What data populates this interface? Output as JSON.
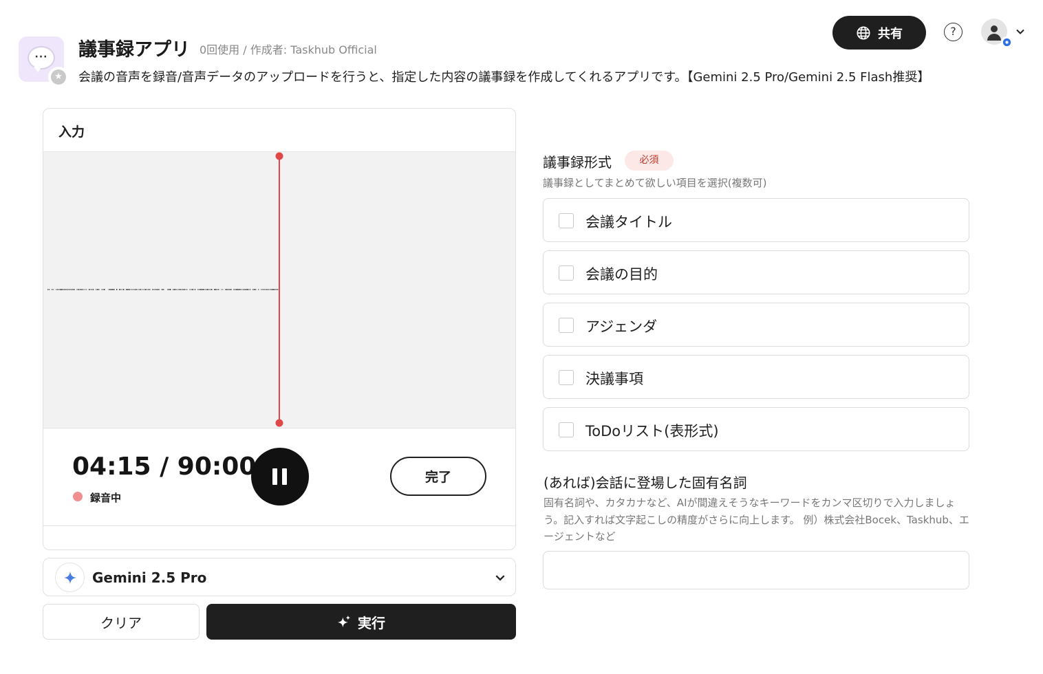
{
  "app": {
    "title": "議事録アプリ",
    "meta": "0回使用 / 作成者: Taskhub Official",
    "description": "会議の音声を録音/音声データのアップロードを行うと、指定した内容の議事録を作成してくれるアプリです。【Gemini 2.5 Pro/Gemini 2.5 Flash推奨】",
    "icon": "speech-bubble-icon",
    "badge_icon": "star-icon"
  },
  "header": {
    "share_label": "共有",
    "share_icon": "globe-icon",
    "help_icon": "question-icon",
    "avatar_icon": "user-icon",
    "settings_badge_icon": "gear-icon",
    "menu_icon": "chevron-down-icon"
  },
  "input_panel": {
    "title": "入力",
    "timer": "04:15 / 90:00",
    "status": "録音中",
    "status_color": "#ef8f8f",
    "playhead_color": "#e04848",
    "pause_icon": "pause-icon",
    "done_label": "完了"
  },
  "model": {
    "selected": "Gemini 2.5 Pro",
    "icon": "gemini-sparkle-icon"
  },
  "actions": {
    "clear_label": "クリア",
    "run_label": "実行",
    "run_icon": "sparkle-icon"
  },
  "format_field": {
    "label": "議事録形式",
    "required": "必須",
    "help": "議事録としてまとめて欲しい項目を選択(複数可)",
    "options": [
      {
        "label": "会議タイトル",
        "checked": false
      },
      {
        "label": "会議の目的",
        "checked": false
      },
      {
        "label": "アジェンダ",
        "checked": false
      },
      {
        "label": "決議事項",
        "checked": false
      },
      {
        "label": "ToDoリスト(表形式)",
        "checked": false
      }
    ]
  },
  "proper_nouns_field": {
    "label": "(あれば)会話に登場した固有名詞",
    "help": "固有名詞や、カタカナなど、AIが間違えそうなキーワードをカンマ区切りで入力しましょう。記入すれば文字起こしの精度がさらに向上します。 例）株式会社Bocek、Taskhub、エージェントなど",
    "value": "",
    "placeholder": ""
  }
}
